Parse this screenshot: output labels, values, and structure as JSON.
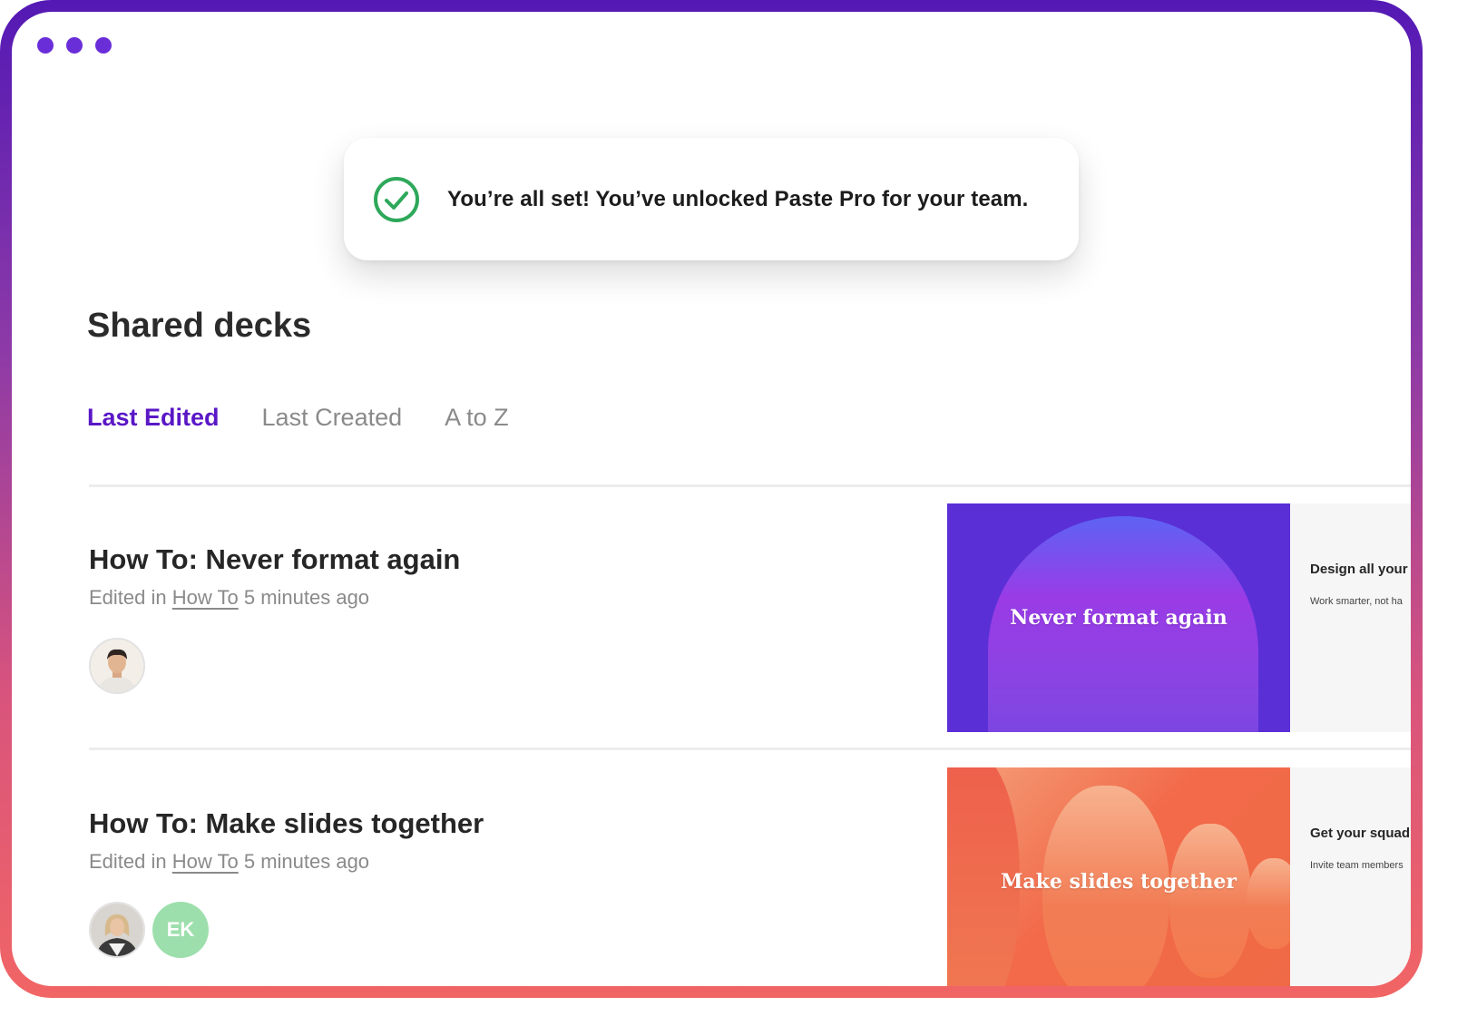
{
  "toast": {
    "message": "You’re all set! You’ve unlocked Paste Pro for your team."
  },
  "page": {
    "title": "Shared decks"
  },
  "tabs": [
    {
      "label": "Last Edited",
      "active": true
    },
    {
      "label": "Last Created",
      "active": false
    },
    {
      "label": "A to Z",
      "active": false
    }
  ],
  "decks": [
    {
      "title": "How To: Never format again",
      "meta_prefix": "Edited in",
      "folder": "How To",
      "time": "5 minutes ago",
      "thumb_title": "Never format again",
      "side_title": "Design all your",
      "side_sub": "Work smarter, not ha"
    },
    {
      "title": "How To: Make slides together",
      "meta_prefix": "Edited in",
      "folder": "How To",
      "time": "5 minutes ago",
      "thumb_title": "Make slides together",
      "side_title": "Get your squad",
      "side_sub": "Invite team members",
      "collaborator_initials": "EK"
    }
  ],
  "colors": {
    "accent": "#5a17c6",
    "success": "#2ea85a",
    "frame_top": "#5419b5",
    "frame_bottom": "#f16565",
    "initials_avatar": "#9ddfac"
  }
}
